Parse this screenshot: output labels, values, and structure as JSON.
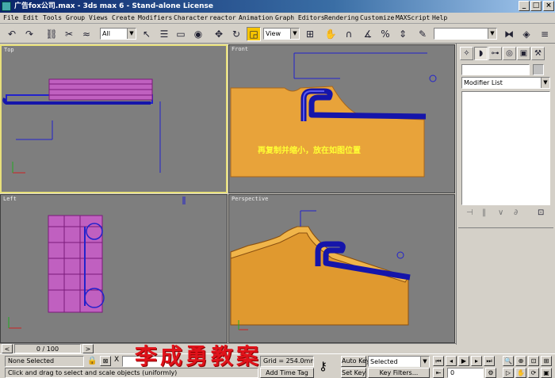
{
  "window": {
    "title": "广告fox公司.max - 3ds max 6 - Stand-alone License",
    "min": "_",
    "max": "□",
    "close": "×"
  },
  "menu": [
    "File",
    "Edit",
    "Tools",
    "Group",
    "Views",
    "Create",
    "Modifiers",
    "Character",
    "reactor",
    "Animation",
    "Graph Editors",
    "Rendering",
    "Customize",
    "MAXScript",
    "Help"
  ],
  "toolbar": {
    "selection_filter": "All",
    "ref_coord": "View",
    "named_selection": "",
    "icons": [
      "undo-icon",
      "redo-icon",
      "link-icon",
      "unlink-icon",
      "bind-space-warp-icon",
      "select-icon",
      "select-by-name-icon",
      "rect-region-icon",
      "window-crossing-icon",
      "move-icon",
      "rotate-icon",
      "scale-icon",
      "pivot-center-icon",
      "mirror-icon",
      "align-icon",
      "angle-snap-icon",
      "percent-snap-icon",
      "spinner-snap-icon",
      "edit-named-sel-icon"
    ]
  },
  "viewports": {
    "top": "Top",
    "front": "Front",
    "left": "Left",
    "perspective": "Perspective"
  },
  "annotation": "再复制并缩小，放在如图位置",
  "command_panel": {
    "name_field": "",
    "modifier_list": "Modifier List"
  },
  "timeline": {
    "frame": "0 / 100",
    "back": "<",
    "forward": ">"
  },
  "status": {
    "selection": "None Selected",
    "prompt": "Click and drag to select and scale objects (uniformly)",
    "grid": "Grid = 254.0mm",
    "add_time_tag": "Add Time Tag",
    "auto_key": "Auto Key",
    "set_key": "Set Key",
    "key_mode": "Selected",
    "key_filters": "Key Filters...",
    "frame_field": "0"
  },
  "watermark": "李成勇教案",
  "colors": {
    "active_border": "#e8e07a",
    "viewport_bg": "#7e7e7e",
    "object_orange": "#e8a33a",
    "object_blue": "#2222cc",
    "annotation_yellow": "#ffff33",
    "watermark_red": "#e0121a"
  }
}
